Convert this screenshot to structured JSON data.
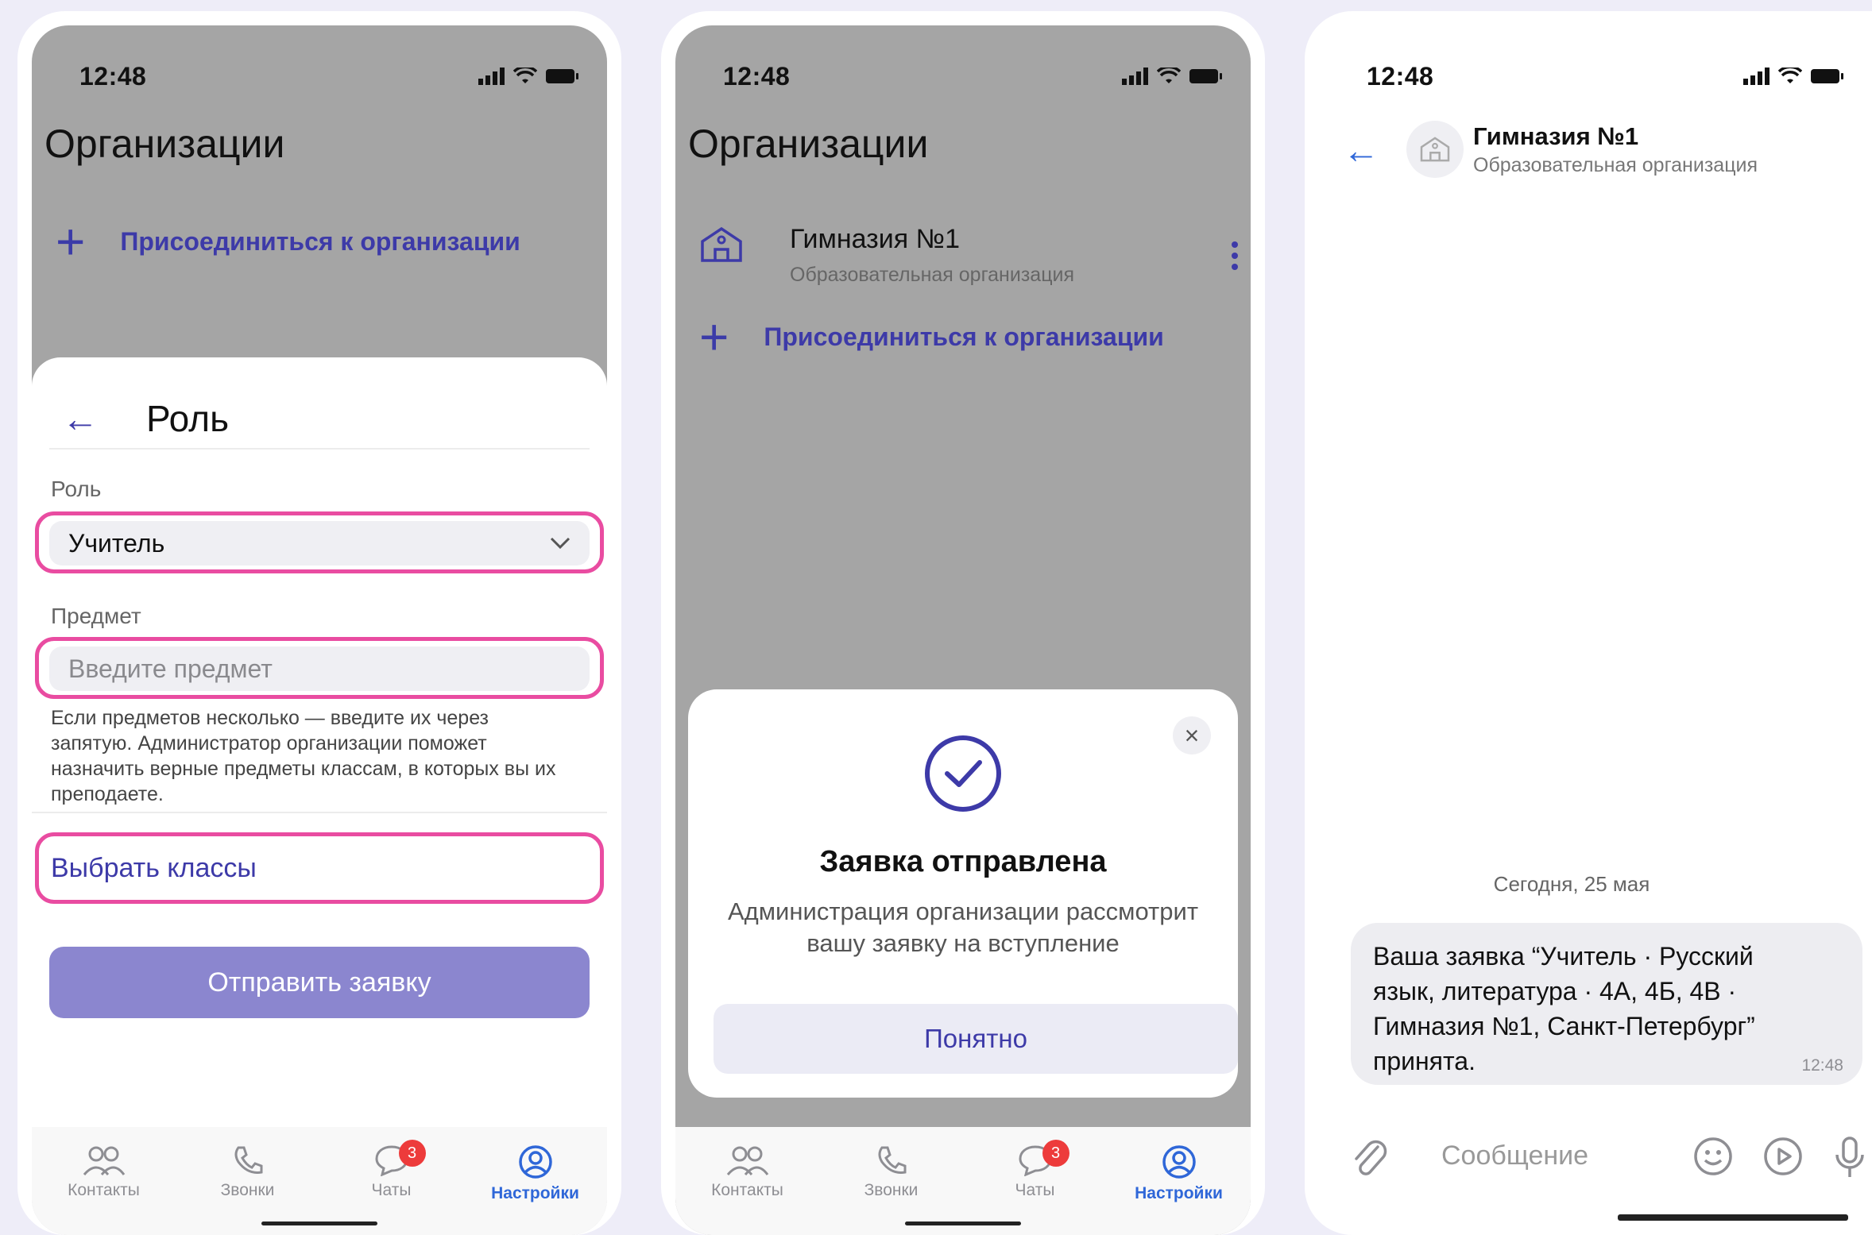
{
  "status": {
    "time": "12:48"
  },
  "phone1": {
    "title": "Организации",
    "join": "Присоединиться к организации",
    "sheet": {
      "title": "Роль",
      "role_label": "Роль",
      "role_value": "Учитель",
      "subject_label": "Предмет",
      "subject_placeholder": "Введите предмет",
      "hint": "Если предметов несколько — введите их через запятую. Администратор организации поможет назначить верные предметы классам, в которых вы их преподаете.",
      "choose_classes": "Выбрать классы",
      "submit": "Отправить заявку"
    },
    "highlight_color": "#e94ca1"
  },
  "tabs": [
    {
      "label": "Контакты",
      "icon": "contacts-icon"
    },
    {
      "label": "Звонки",
      "icon": "phone-icon"
    },
    {
      "label": "Чаты",
      "icon": "chat-icon",
      "badge": "3"
    },
    {
      "label": "Настройки",
      "icon": "profile-icon",
      "active": true
    }
  ],
  "phone2": {
    "title": "Организации",
    "org_name": "Гимназия №1",
    "org_sub": "Образовательная организация",
    "join": "Присоединиться к организации",
    "modal": {
      "title": "Заявка отправлена",
      "text": "Администрация организации рассмотрит вашу заявку на вступление",
      "ok": "Понятно"
    }
  },
  "phone3": {
    "name": "Гимназия №1",
    "sub": "Образовательная организация",
    "date": "Сегодня, 25 мая",
    "message": "Ваша заявка “Учитель · Русский язык, литература · 4А, 4Б, 4В · Гимназия №1, Санкт-Петербург” принята.",
    "message_time": "12:48",
    "composer_placeholder": "Сообщение"
  },
  "colors": {
    "accent": "#3d3aa8",
    "active_tab": "#2f67d8",
    "badge": "#ed3b3b",
    "submit": "#8b86cf"
  }
}
